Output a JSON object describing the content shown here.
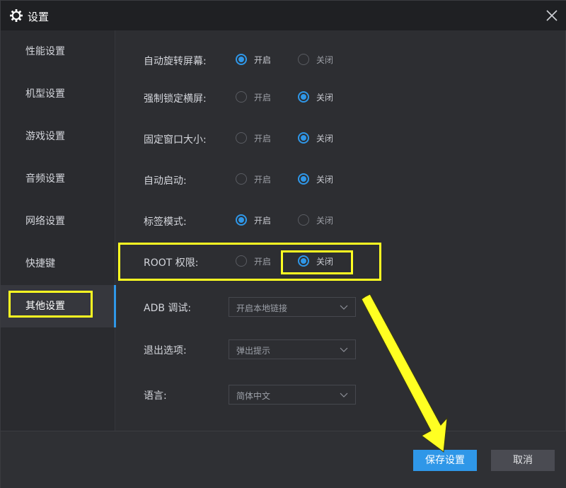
{
  "window": {
    "title": "设置"
  },
  "sidebar": {
    "items": [
      {
        "label": "性能设置",
        "active": false
      },
      {
        "label": "机型设置",
        "active": false
      },
      {
        "label": "游戏设置",
        "active": false
      },
      {
        "label": "音频设置",
        "active": false
      },
      {
        "label": "网络设置",
        "active": false
      },
      {
        "label": "快捷键",
        "active": false
      },
      {
        "label": "其他设置",
        "active": true
      }
    ]
  },
  "settings": {
    "on_label": "开启",
    "off_label": "关闭",
    "toggles": [
      {
        "label": "自动旋转屏幕:",
        "value": "on"
      },
      {
        "label": "强制锁定横屏:",
        "value": "off"
      },
      {
        "label": "固定窗口大小:",
        "value": "off"
      },
      {
        "label": "自动启动:",
        "value": "off"
      },
      {
        "label": "标签模式:",
        "value": "on"
      },
      {
        "label": "ROOT 权限:",
        "value": "off"
      }
    ],
    "selects": [
      {
        "label": "ADB 调试:",
        "value": "开启本地链接"
      },
      {
        "label": "退出选项:",
        "value": "弹出提示"
      },
      {
        "label": "语言:",
        "value": "简体中文"
      }
    ]
  },
  "footer": {
    "save_label": "保存设置",
    "cancel_label": "取消"
  },
  "colors": {
    "accent": "#2f97e8",
    "highlight": "#ffff22",
    "background": "#2d2e32",
    "titlebar": "#1f2023"
  }
}
